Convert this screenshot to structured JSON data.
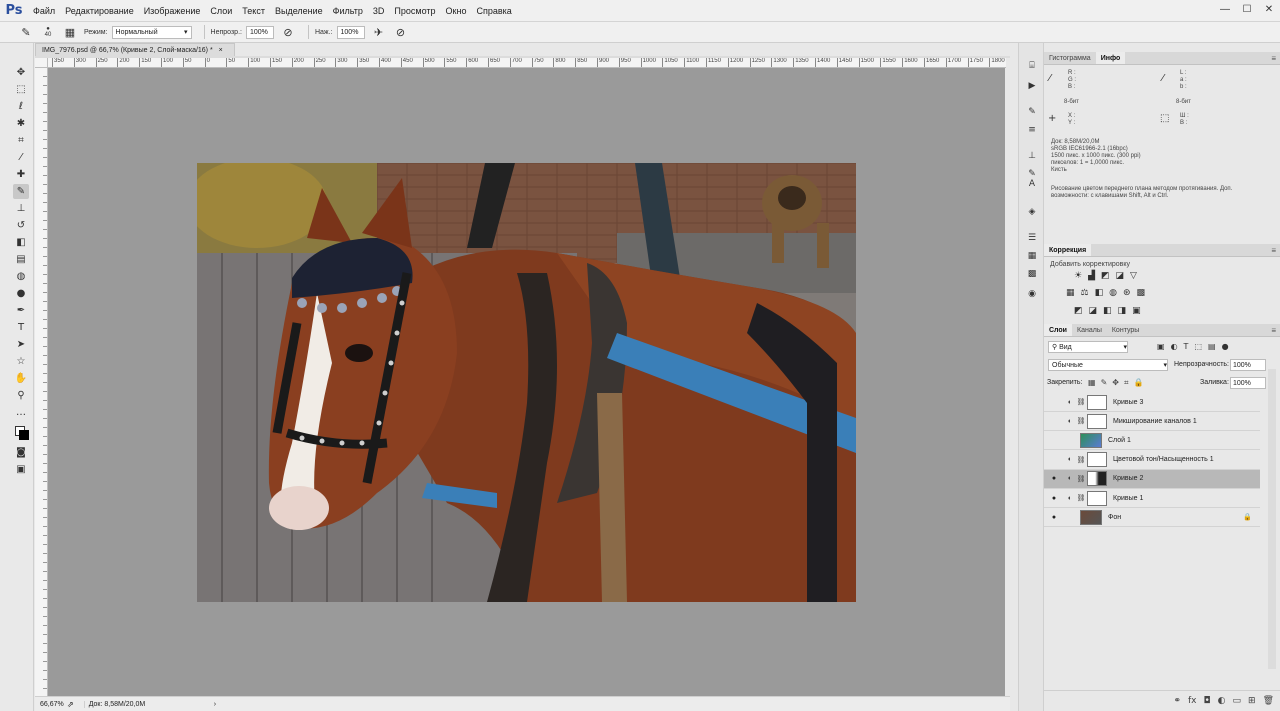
{
  "app": {
    "logo": "Ps"
  },
  "menu": [
    "Файл",
    "Редактирование",
    "Изображение",
    "Слои",
    "Текст",
    "Выделение",
    "Фильтр",
    "3D",
    "Просмотр",
    "Окно",
    "Справка"
  ],
  "window_controls": {
    "minimize": "—",
    "maximize": "☐",
    "close": "✕"
  },
  "options": {
    "brush_size": "40",
    "mode_label": "Режим:",
    "mode_value": "Нормальный",
    "opacity_label": "Непрозр.:",
    "opacity_value": "100%",
    "flow_label": "Наж.:",
    "flow_value": "100%"
  },
  "document": {
    "tab_title": "IMG_7976.psd @ 66,7% (Кривые 2, Слой-маска/16) *",
    "tab_close": "×",
    "zoom": "66,67%",
    "doc_size": "Док: 8,58M/20,0M",
    "ruler_ticks": [
      "350",
      "300",
      "250",
      "200",
      "150",
      "100",
      "50",
      "0",
      "50",
      "100",
      "150",
      "200",
      "250",
      "300",
      "350",
      "400",
      "450",
      "500",
      "550",
      "600",
      "650",
      "700",
      "750",
      "800",
      "850",
      "900",
      "950",
      "1000",
      "1050",
      "1100",
      "1150",
      "1200",
      "1250",
      "1300",
      "1350",
      "1400",
      "1450",
      "1500",
      "1550",
      "1600",
      "1650",
      "1700",
      "1750",
      "1800"
    ]
  },
  "panels": {
    "info_tabs": [
      "Гистограмма",
      "Инфо"
    ],
    "info": {
      "rgb_left": [
        "R :",
        "G :",
        "B :"
      ],
      "lab_right": [
        "L :",
        "a :",
        "b :"
      ],
      "bit_left": "8-бит",
      "bit_right": "8-бит",
      "xy": [
        "X :",
        "Y :"
      ],
      "wh": [
        "Ш :",
        "В :"
      ],
      "doc_lines": [
        "Док: 8,58M/20,0M",
        "sRGB IEC61966-2.1 (16bpc)",
        "1500 пикс. x 1000 пикс. (300 ppi)",
        "пикселов: 1 = 1,0000 пикс.",
        "Кисть"
      ],
      "hint": "Рисование цветом переднего плана методом протягивания. Доп. возможности: с клавишами Shift, Alt и Ctrl."
    },
    "correction_tab": "Коррекция",
    "correction_add": "Добавить корректировку",
    "layers_tabs": [
      "Слои",
      "Каналы",
      "Контуры"
    ],
    "layer_filter": "Вид",
    "blend_mode": "Обычные",
    "opacity_label": "Непрозрачность:",
    "opacity_value": "100%",
    "lock_label": "Закрепить:",
    "fill_label": "Заливка:",
    "fill_value": "100%",
    "layers": [
      {
        "name": "Кривые 3",
        "visible": false,
        "type": "adj"
      },
      {
        "name": "Микширование каналов 1",
        "visible": false,
        "type": "adj"
      },
      {
        "name": "Слой 1",
        "visible": false,
        "type": "image"
      },
      {
        "name": "Цветовой тон/Насыщенность 1",
        "visible": false,
        "type": "adj"
      },
      {
        "name": "Кривые 2",
        "visible": true,
        "type": "adj",
        "selected": true
      },
      {
        "name": "Кривые 1",
        "visible": true,
        "type": "adj"
      },
      {
        "name": "Фон",
        "visible": true,
        "type": "bg"
      }
    ]
  }
}
